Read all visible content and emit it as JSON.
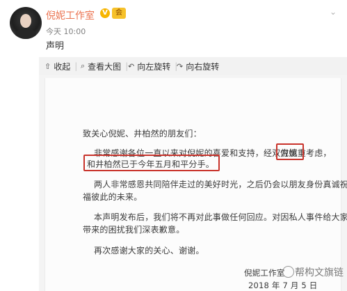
{
  "author": {
    "name": "倪妮工作室",
    "verified_mark": "V",
    "vip_badge": "会"
  },
  "post": {
    "time": "今天 10:00",
    "text": "声明"
  },
  "toolbar": {
    "collapse": "收起",
    "view_large": "查看大图",
    "rotate_left": "向左旋转",
    "rotate_right": "向右旋转"
  },
  "statement": {
    "greeting": "致关心倪妮、井柏然的朋友们：",
    "para1_line1_a": "非常感谢各位一直以来对倪妮的喜爱和支持，经双方慎重考虑，",
    "para1_line1_b": "倪妮",
    "para1_line2_a": "和井柏然已于今年五月和平分手。",
    "para2_line1": "两人非常感恩共同陪伴走过的美好时光，之后仍会以朋友身份真诚祝",
    "para2_line2": "福彼此的未来。",
    "para3_line1": "本声明发布后，我们将不再对此事做任何回应。对因私人事件给大家",
    "para3_line2": "带来的困扰我们深表歉意。",
    "para4": "再次感谢大家的关心、谢谢。",
    "signature": "倪妮工作室",
    "date": "2018 年 7 月 5 日"
  },
  "watermark": "帮构文旗链",
  "colors": {
    "name_orange": "#eb7350",
    "highlight_red": "#c8322a",
    "toolbar_bg": "#f2f2f2"
  }
}
